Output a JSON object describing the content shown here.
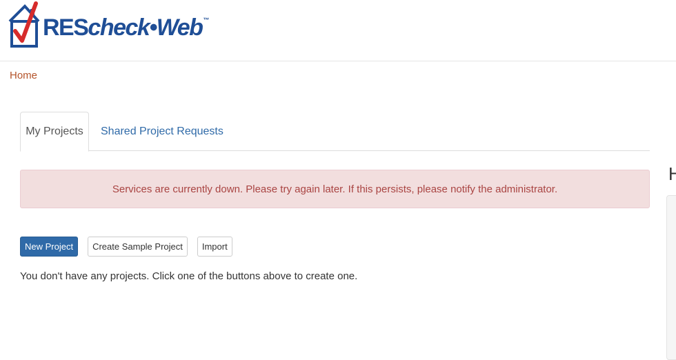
{
  "header": {
    "logo": {
      "text_bold": "RES",
      "text_rest": "check•Web",
      "trademark": "™",
      "icon": "house-checkmark-icon",
      "colors": {
        "house": "#1f4e96",
        "check": "#d62b2b",
        "text": "#1f4e96"
      }
    }
  },
  "breadcrumb": {
    "home_label": "Home"
  },
  "tabs": [
    {
      "label": "My Projects",
      "active": true
    },
    {
      "label": "Shared Project Requests",
      "active": false
    }
  ],
  "alert": {
    "message": "Services are currently down. Please try again later. If this persists, please notify the administrator.",
    "colors": {
      "background": "#f2dede",
      "text": "#a94442"
    }
  },
  "actions": {
    "new_project_label": "New Project",
    "create_sample_label": "Create Sample Project",
    "import_label": "Import"
  },
  "empty_message": "You don't have any projects. Click one of the buttons above to create one.",
  "side": {
    "heading_fragment": "H"
  },
  "colors": {
    "accent": "#2f6aa8",
    "link_home": "#b4532a"
  }
}
